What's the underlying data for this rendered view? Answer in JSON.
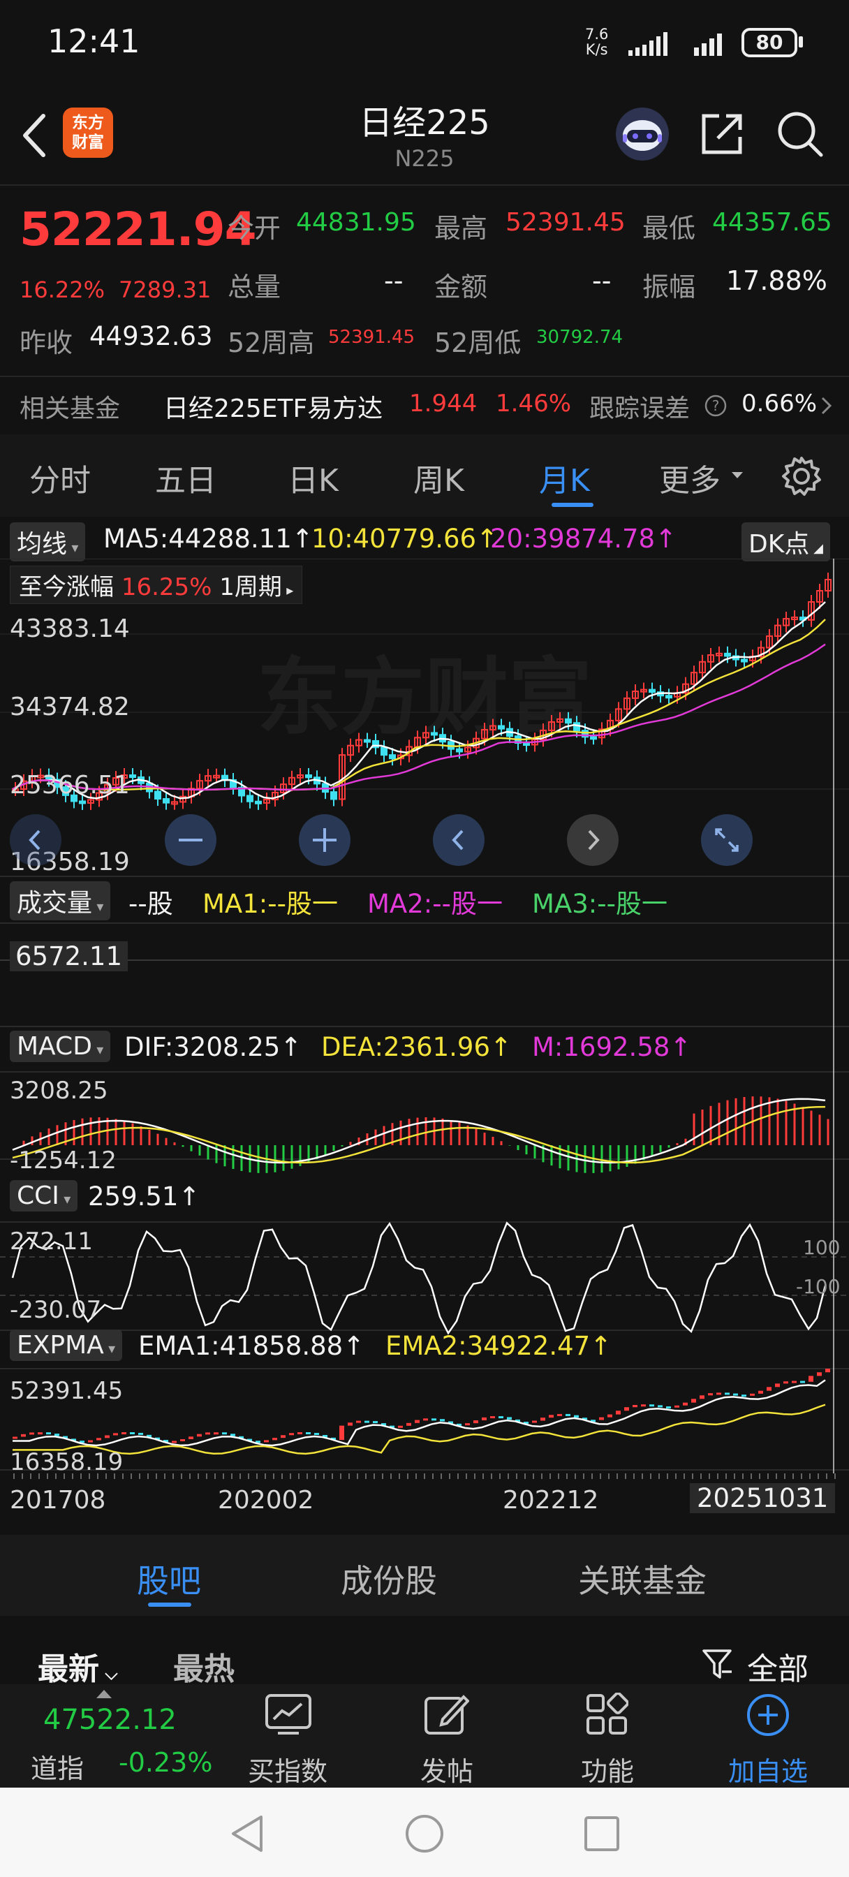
{
  "status_bar": {
    "time": "12:41",
    "net_speed_value": "7.6",
    "net_speed_unit": "K/s",
    "battery": "80"
  },
  "header": {
    "title": "日经225",
    "subtitle": "N225",
    "logo_text": "东方财富"
  },
  "quote": {
    "price": "52221.94",
    "change_pct": "16.22%",
    "change": "7289.31",
    "open_label": "今开",
    "open": "44831.95",
    "high_label": "最高",
    "high": "52391.45",
    "low_label": "最低",
    "low": "44357.65",
    "volume_label": "总量",
    "volume": "--",
    "amount_label": "金额",
    "amount": "--",
    "amplitude_label": "振幅",
    "amplitude": "17.88%",
    "prev_close_label": "昨收",
    "prev_close": "44932.63",
    "wk52_high_label": "52周高",
    "wk52_high": "52391.45",
    "wk52_low_label": "52周低",
    "wk52_low": "30792.74"
  },
  "fund_row": {
    "label": "相关基金",
    "name": "日经225ETF易方达",
    "price": "1.944",
    "pct": "1.46%",
    "tracking_label": "跟踪误差",
    "tracking": "0.66%"
  },
  "tabs": [
    "分时",
    "五日",
    "日K",
    "周K",
    "月K",
    "更多"
  ],
  "active_tab": "月K",
  "chart": {
    "ma_chip": "均线",
    "ma5": "MA5:44288.11↑",
    "ma10": "10:40779.66↑",
    "ma20": "20:39874.78↑",
    "dk_chip": "DK点",
    "gain_label": "至今涨幅",
    "gain_value": "16.25%",
    "gain_period": "1周期",
    "y_labels": [
      "43383.14",
      "34374.82",
      "25366.51",
      "16358.19"
    ],
    "watermark": "东方财富",
    "vol_chip": "成交量",
    "vol_unit": "--股",
    "vol_ma1": "MA1:--股一",
    "vol_ma2": "MA2:--股一",
    "vol_ma3": "MA3:--股一",
    "vol_value": "6572.11",
    "macd_chip": "MACD",
    "dif": "DIF:3208.25↑",
    "dea": "DEA:2361.96↑",
    "m": "M:1692.58↑",
    "macd_top": "3208.25",
    "macd_bottom": "-1254.12",
    "cci_chip": "CCI",
    "cci_value": "259.51↑",
    "cci_top": "272.11",
    "cci_bottom": "-230.07",
    "cci_ref_top": "100",
    "cci_ref_bottom": "-100",
    "expma_chip": "EXPMA",
    "ema1": "EMA1:41858.88↑",
    "ema2": "EMA2:34922.47↑",
    "expma_top": "52391.45",
    "expma_bottom": "16358.19",
    "x_labels": [
      "201708",
      "202002",
      "202212",
      "20251031"
    ]
  },
  "bottom_tabs": [
    "股吧",
    "成份股",
    "关联基金"
  ],
  "active_bottom_tab": "股吧",
  "feed": {
    "latest": "最新",
    "hot": "最热",
    "filter": "全部"
  },
  "bottom_bar": {
    "ticker_value": "47522.12",
    "ticker_name": "道指",
    "ticker_pct": "-0.23%",
    "buy_index": "买指数",
    "post": "发帖",
    "features": "功能",
    "add_watch": "加自选"
  },
  "colors": {
    "up": "#ff3b3b",
    "down": "#22cc44",
    "accent": "#3a8ff5",
    "ma5": "#ffffff",
    "ma10": "#f3e33a",
    "ma20": "#e23ad8"
  }
}
